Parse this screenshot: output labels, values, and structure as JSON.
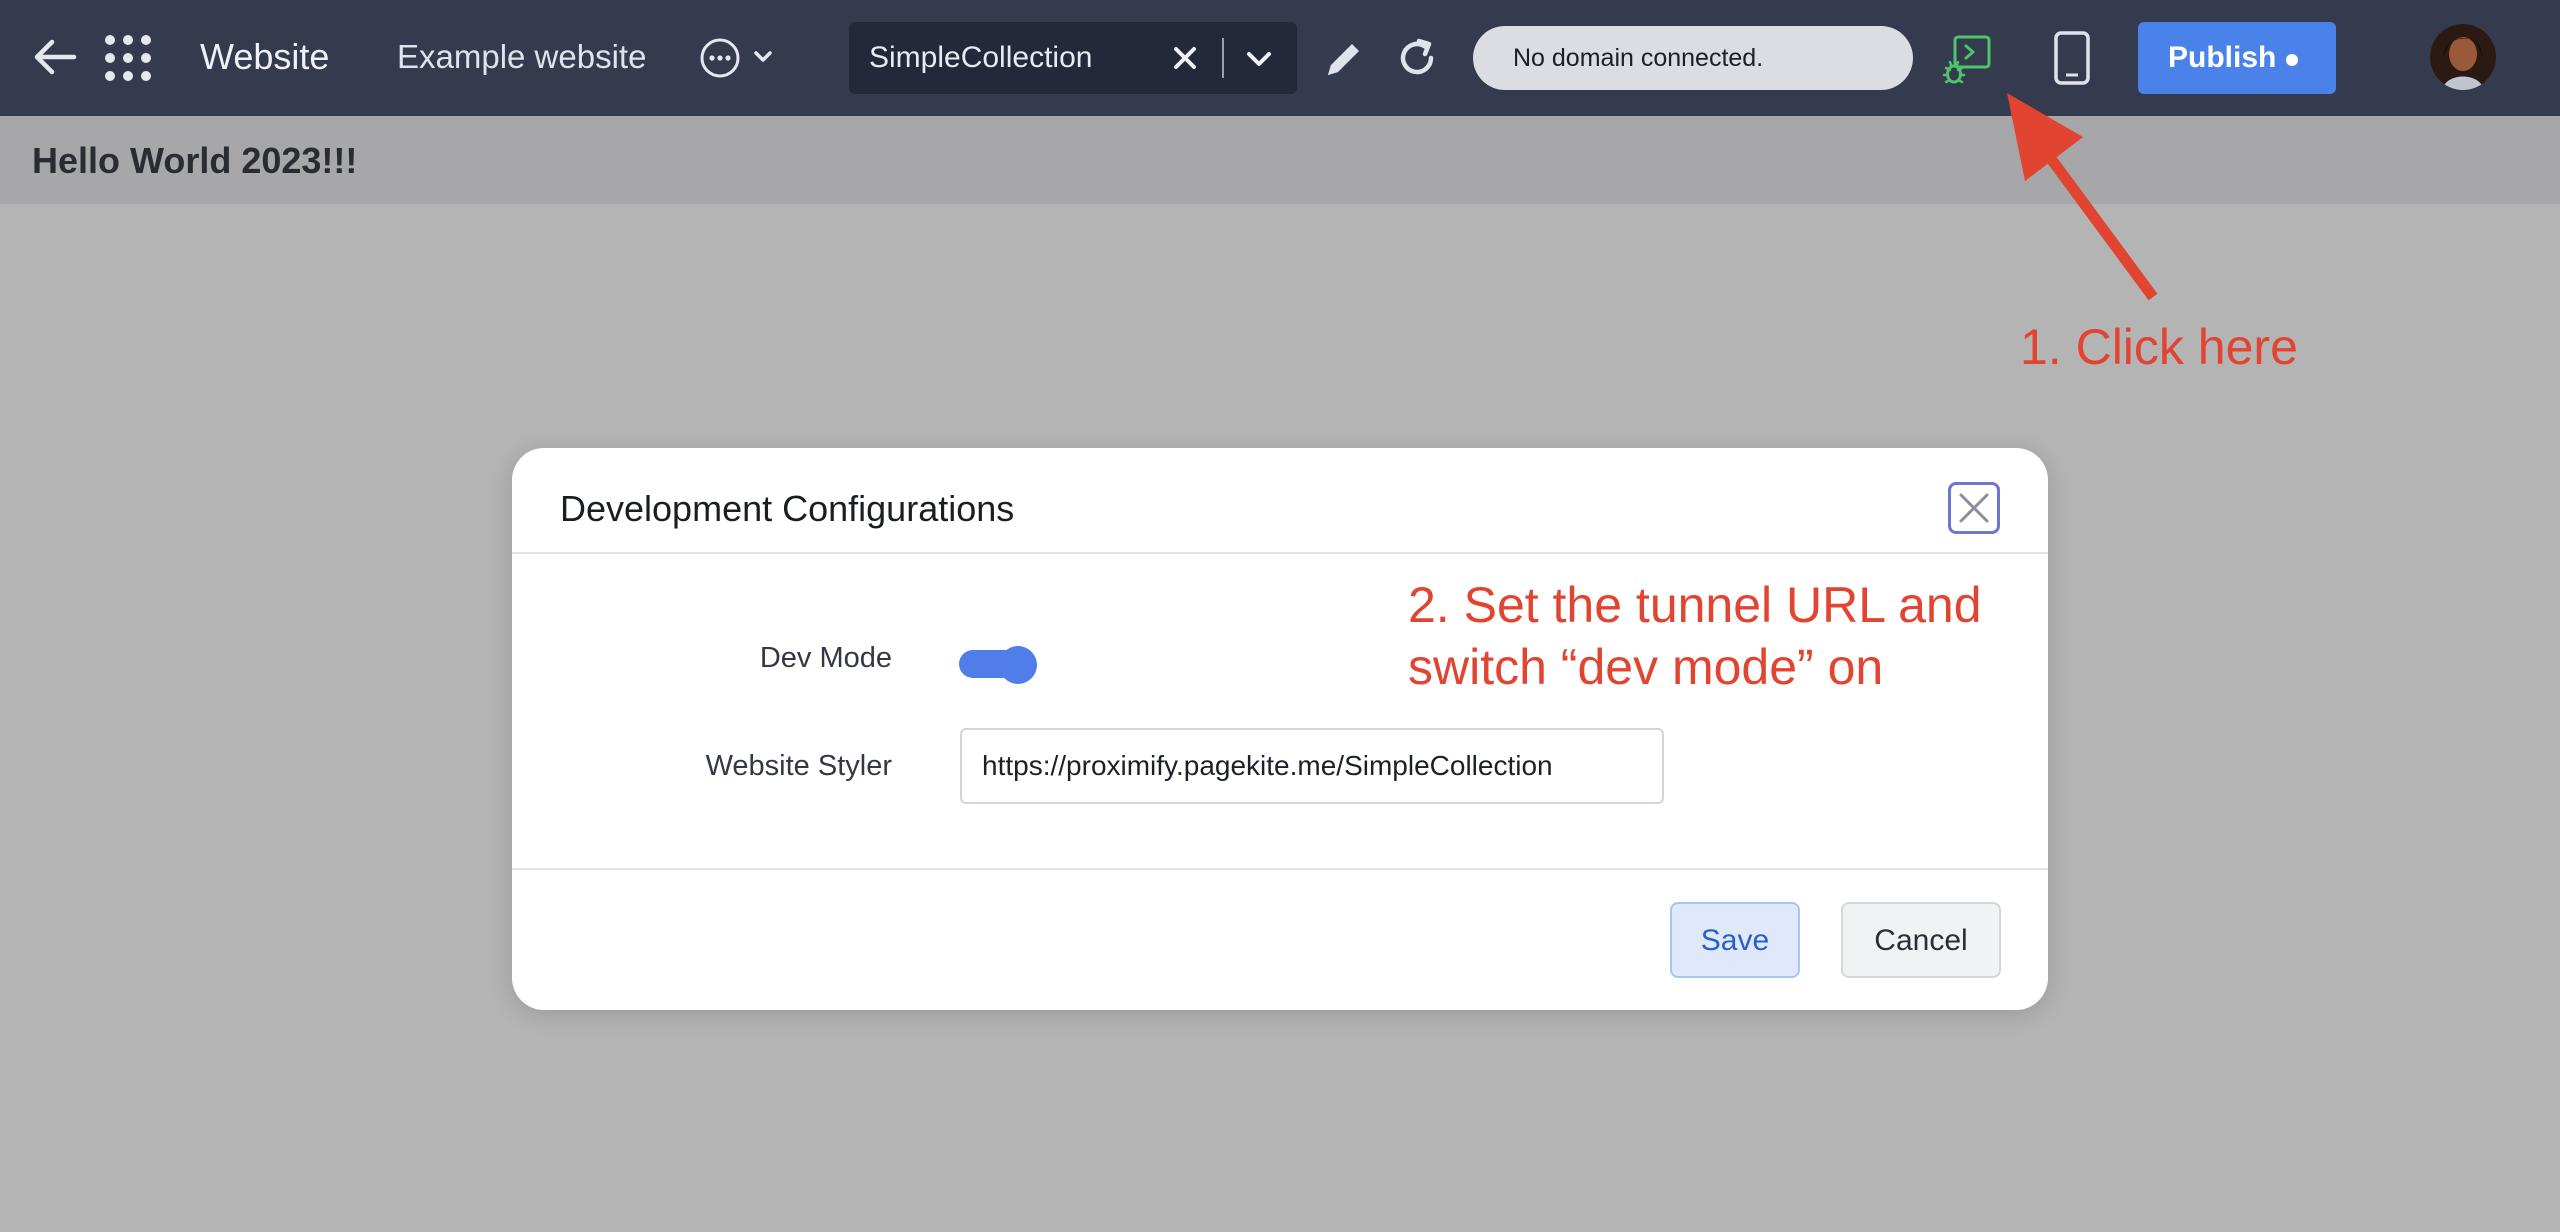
{
  "topbar": {
    "back_icon": "arrow-left-icon",
    "apps_icon": "grid-dots-icon",
    "app_title": "Website",
    "site_name": "Example website",
    "more_icon": "ellipsis-circle-icon",
    "collection_value": "SimpleCollection",
    "domain_status": "No domain connected.",
    "publish_label": "Publish",
    "dev_config_icon": "debug-console-icon",
    "dev_config_color": "#4fc36a",
    "accent_color": "#4b82ea"
  },
  "page": {
    "heading": "Hello World 2023!!!"
  },
  "annotations": {
    "step1": "1. Click here",
    "step2_line1": "2. Set the tunnel URL and",
    "step2_line2": "switch “dev mode” on",
    "color": "#e14431"
  },
  "modal": {
    "title": "Development Configurations",
    "dev_mode_label": "Dev Mode",
    "dev_mode_on": true,
    "styler_label": "Website Styler",
    "styler_url": "https://proximify.pagekite.me/SimpleCollection",
    "save_label": "Save",
    "cancel_label": "Cancel"
  }
}
